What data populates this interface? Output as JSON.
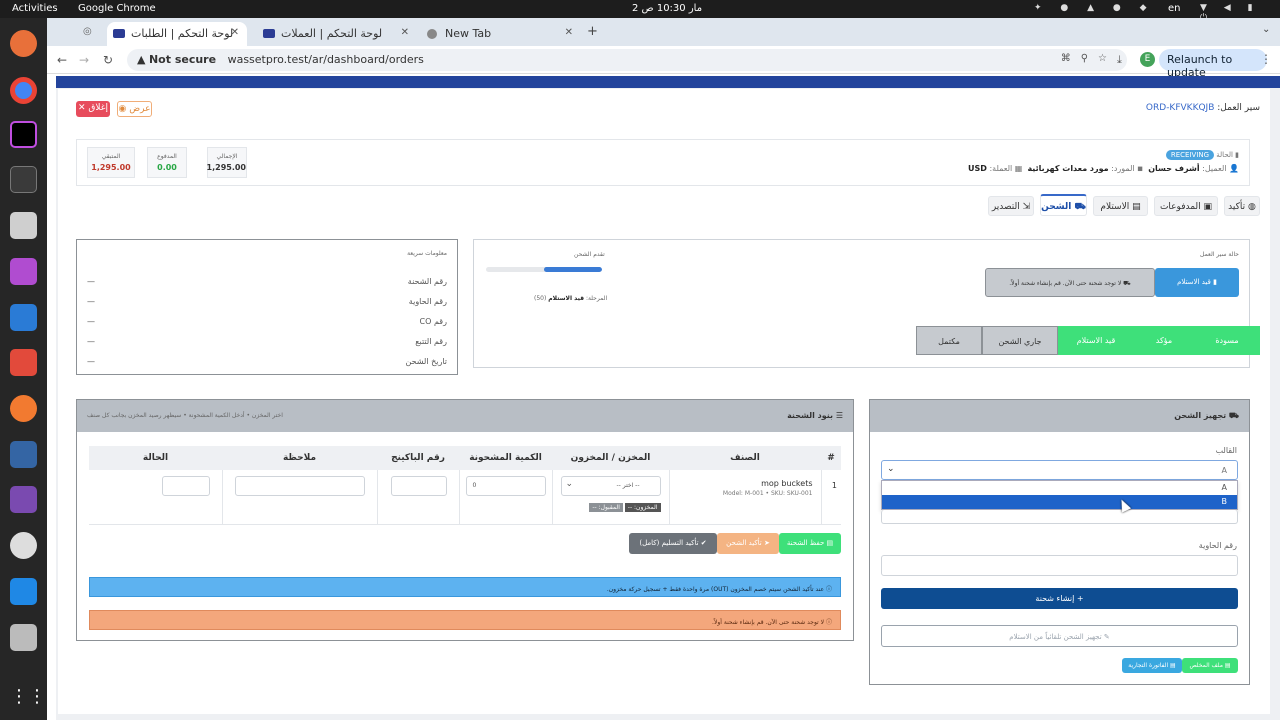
{
  "os": {
    "activities": "Activities",
    "app": "Google Chrome",
    "clock": "2 مار 10:30 ص",
    "lang": "en"
  },
  "browser": {
    "tabs": [
      {
        "title": "لوحة التحكم | الطلبات"
      },
      {
        "title": "لوحة التحكم | العملات"
      },
      {
        "title": "New Tab"
      }
    ],
    "not_secure": "Not secure",
    "url": "wassetpro.test/ar/dashboard/orders",
    "relaunch": "Relaunch to update",
    "profile": "E"
  },
  "order": {
    "label": "سير العمل:",
    "number": "ORD-KFVKKQJB",
    "close": "إغلاق",
    "view": "عرض",
    "status_label": "الحالة",
    "status": "RECEIVING",
    "client_label": "العميل:",
    "client": "أشرف حسان",
    "supplier_label": "المورد:",
    "supplier": "مورد معدات كهربائية",
    "currency_label": "العملة:",
    "currency": "USD",
    "stats": [
      {
        "label": "الإجمالي",
        "value": "1,295.00",
        "color": "#333333"
      },
      {
        "label": "المدفوع",
        "value": "0.00",
        "color": "#28a745"
      },
      {
        "label": "المتبقي",
        "value": "1,295.00",
        "color": "#c0392b"
      }
    ]
  },
  "tabs": [
    "تأكيد",
    "المدفوعات",
    "الاستلام",
    "الشحن",
    "التصدير"
  ],
  "workflow": {
    "title": "حالة سير العمل",
    "current": "قيد الاستلام",
    "notice": "لا توجد شحنة حتى الآن. قم بإنشاء شحنة أولاً.",
    "progress_title": "تقدم الشحن",
    "stage_label": "المرحلة:",
    "stage": "قيد الاستلام",
    "stage_code": "(50)",
    "progress": 0.5,
    "steps": [
      "مسودة",
      "مؤكد",
      "قيد الاستلام",
      "جاري الشحن",
      "مكتمل"
    ]
  },
  "quick": {
    "title": "معلومات سريعة",
    "rows": [
      {
        "label": "رقم الشحنة",
        "value": "—"
      },
      {
        "label": "رقم الحاوية",
        "value": "—"
      },
      {
        "label": "رقم CO",
        "value": "—"
      },
      {
        "label": "رقم التتبع",
        "value": "—"
      },
      {
        "label": "تاريخ الشحن",
        "value": "—"
      }
    ]
  },
  "prep": {
    "title": "تجهيز الشحن",
    "template_label": "القالب",
    "selected": "A",
    "options": [
      "A",
      "B"
    ],
    "container_label": "رقم الحاوية",
    "create": "إنشاء شحنة",
    "fill_from_receiving": "تجهيز الشحن تلقائياً من الاستلام",
    "commercial_invoice": "الفاتورة التجارية",
    "packing": "ملف المخلص"
  },
  "items": {
    "title": "بنود الشحنة",
    "hint": "اختر المخزن • أدخل الكمية المشحونة • سيظهر رصيد المخزن بجانب كل صنف",
    "headers": [
      "#",
      "الصنف",
      "المخزن / المخزون",
      "الكمية المشحونة",
      "رقم الباكينج",
      "ملاحظة",
      "الحالة"
    ],
    "row": {
      "num": "1",
      "name": "mop buckets",
      "meta": "Model: M-001 • SKU: SKU-001",
      "warehouse": "-- اختر --",
      "qty": "0",
      "stock_label": "المخزون: --",
      "accepted_label": "المقبول: --"
    },
    "save": "حفظ الشحنة",
    "confirm": "تأكيد الشحن",
    "confirm_full": "تأكيد التسليم (كامل)",
    "info": "عند تأكيد الشحن سيتم خصم المخزون (OUT) مرة واحدة فقط + تسجيل حركة مخزون.",
    "warn": "لا توجد شحنة حتى الآن. قم بإنشاء شحنة أولاً."
  }
}
